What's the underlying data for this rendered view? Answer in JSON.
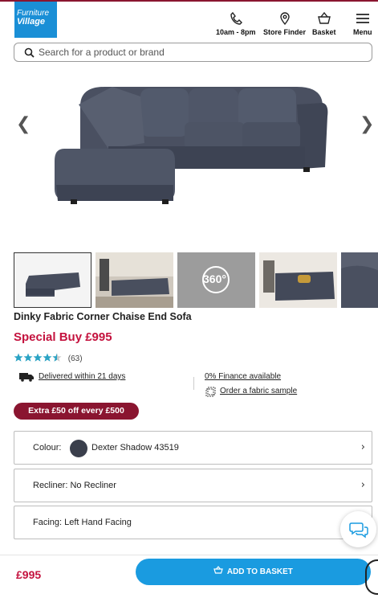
{
  "header": {
    "logo_line1": "Furniture",
    "logo_line2": "Village",
    "hours_label": "10am - 8pm",
    "store_label": "Store Finder",
    "basket_label": "Basket",
    "menu_label": "Menu"
  },
  "search": {
    "placeholder": "Search for a product or brand"
  },
  "gallery": {
    "prev_arrow": "❮",
    "next_arrow": "❯",
    "badge_360": "360°"
  },
  "product": {
    "title": "Dinky Fabric Corner Chaise End Sofa",
    "price_label": "Special Buy £995",
    "rating": 4.5,
    "review_count": "(63)",
    "delivery": "Delivered within 21 days",
    "finance": "0% Finance available",
    "sample": "Order a fabric sample",
    "promo": "Extra £50 off every £500"
  },
  "options": {
    "colour_label": "Colour:",
    "colour_value": "Dexter Shadow 43519",
    "colour_hex": "#3a3f4c",
    "recliner": "Recliner: No Recliner",
    "facing": "Facing: Left Hand Facing",
    "chevron": "›"
  },
  "footer": {
    "price": "£995",
    "add_label": "ADD TO BASKET"
  },
  "colors": {
    "brand_blue": "#1a8fd6",
    "sale_red": "#c4123e",
    "promo_bg": "#8a1530",
    "cta_blue": "#1a9be0",
    "star": "#2aa3c4"
  }
}
